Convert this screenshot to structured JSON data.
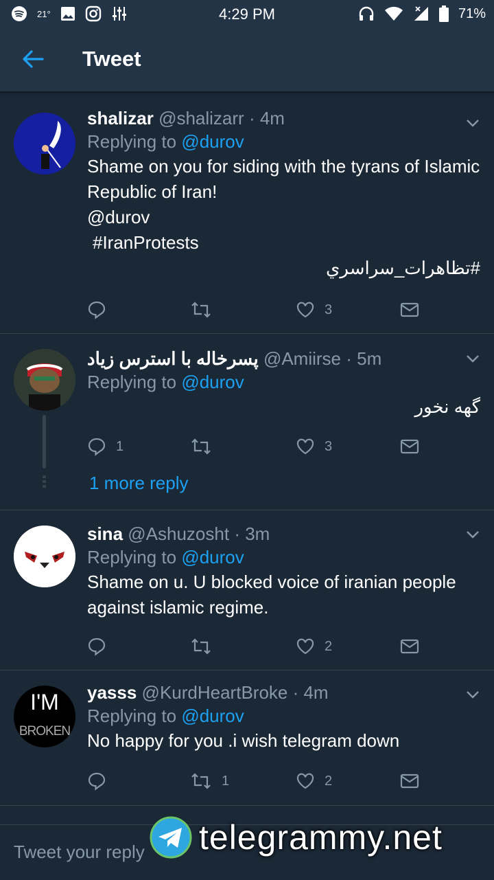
{
  "status_bar": {
    "temperature": "21°",
    "time": "4:29 PM",
    "battery": "71%"
  },
  "app_bar": {
    "title": "Tweet"
  },
  "tweets": [
    {
      "name": "shalizar",
      "handle": "@shalizarr",
      "time": "· 4m",
      "replying_label": "Replying to",
      "replying_to": "@durov",
      "text": "Shame on you for siding with the tyrans of Islamic Republic of Iran!",
      "mention": "@durov",
      "hashtag": "#IranProtests",
      "hashtag_fa": "#تظاهرات_سراسري",
      "replies": "",
      "retweets": "",
      "likes": "3"
    },
    {
      "name": "پسرخاله با استرس زیاد",
      "handle": "@Amiirse",
      "time": "· 5m",
      "replying_label": "Replying to",
      "replying_to": "@durov",
      "text": "گهه نخور",
      "replies": "1",
      "retweets": "",
      "likes": "3",
      "more_replies": "1 more reply"
    },
    {
      "name": "sina",
      "handle": "@Ashuzosht",
      "time": "· 3m",
      "replying_label": "Replying to",
      "replying_to": "@durov",
      "text": "Shame on u. U blocked voice of iranian people against islamic regime.",
      "replies": "",
      "retweets": "",
      "likes": "2"
    },
    {
      "name": "yasss",
      "handle": "@KurdHeartBroke",
      "time": "· 4m",
      "replying_label": "Replying to",
      "replying_to": "@durov",
      "text": "No happy for you .i wish telegram down",
      "avatar_text_top": "I'M",
      "avatar_text_bottom": "BROKEN",
      "replies": "",
      "retweets": "1",
      "likes": "2"
    }
  ],
  "composer": {
    "placeholder": "Tweet your reply"
  },
  "watermark": {
    "text": "telegrammy.net"
  },
  "colors": {
    "background": "#1b2836",
    "bar": "#243447",
    "accent": "#1da1f2",
    "muted": "#8899a6"
  }
}
